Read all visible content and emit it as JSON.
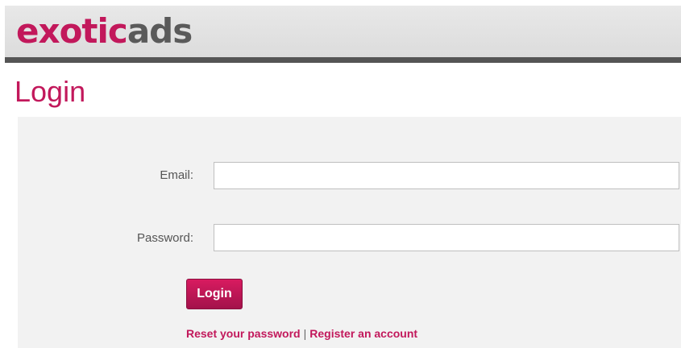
{
  "header": {
    "logo_part1": "exotic",
    "logo_part2": "ads"
  },
  "page": {
    "title": "Login"
  },
  "form": {
    "email_label": "Email:",
    "email_value": "",
    "password_label": "Password:",
    "password_value": "",
    "login_button": "Login"
  },
  "links": {
    "reset": "Reset your password",
    "separator": "|",
    "register": "Register an account"
  },
  "colors": {
    "brand": "#c2185b",
    "header_bar": "#555555",
    "panel_bg": "#f2f2f2"
  }
}
